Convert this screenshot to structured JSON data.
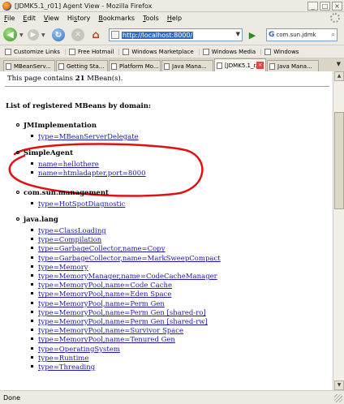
{
  "window": {
    "title": "[JDMK5.1_r01] Agent View - Mozilla Firefox"
  },
  "menu": [
    "File",
    "Edit",
    "View",
    "History",
    "Bookmarks",
    "Tools",
    "Help"
  ],
  "menu_underline": [
    "F",
    "E",
    "V",
    "s",
    "B",
    "T",
    "H"
  ],
  "nav": {
    "url": "http://localhost:8000/",
    "search": "com.sun.jdmk"
  },
  "bookmarks": [
    "Customize Links",
    "Free Hotmail",
    "Windows Marketplace",
    "Windows Media",
    "Windows"
  ],
  "tabs": [
    "MBeanServ...",
    "Getting Sta...",
    "Platform Mo...",
    "Java Mana...",
    "[JDMK5.1_r...",
    "Java Mana..."
  ],
  "active_tab_index": 4,
  "page": {
    "count_prefix": "This page contains ",
    "count_value": "21",
    "count_suffix": " MBean(s).",
    "list_heading": "List of registered MBeans by domain:",
    "domains": [
      {
        "name": "JMImplementation",
        "mbeans": [
          "type=MBeanServerDelegate"
        ]
      },
      {
        "name": "SimpleAgent",
        "mbeans": [
          "name=hellothere",
          "name=htmladapter,port=8000"
        ]
      },
      {
        "name": "com.sun.management",
        "mbeans": [
          "type=HotSpotDiagnostic"
        ]
      },
      {
        "name": "java.lang",
        "mbeans": [
          "type=ClassLoading",
          "type=Compilation",
          "type=GarbageCollector,name=Copy",
          "type=GarbageCollector,name=MarkSweepCompact",
          "type=Memory",
          "type=MemoryManager,name=CodeCacheManager",
          "type=MemoryPool,name=Code Cache",
          "type=MemoryPool,name=Eden Space",
          "type=MemoryPool,name=Perm Gen",
          "type=MemoryPool,name=Perm Gen [shared-ro]",
          "type=MemoryPool,name=Perm Gen [shared-rw]",
          "type=MemoryPool,name=Survivor Space",
          "type=MemoryPool,name=Tenured Gen",
          "type=OperatingSystem",
          "type=Runtime",
          "type=Threading"
        ]
      }
    ]
  },
  "status": {
    "text": "Done"
  },
  "colors": {
    "annotation": "#e01010",
    "link": "#1a1aa6",
    "url_highlight": "#316ac5"
  }
}
